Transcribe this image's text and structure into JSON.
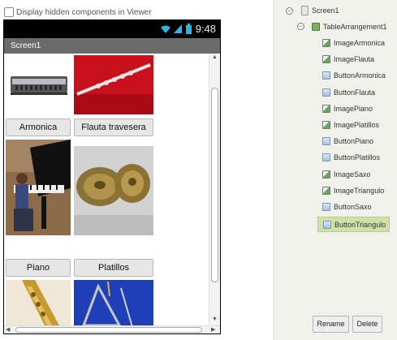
{
  "viewer": {
    "hidden_components_label": "Display hidden components in Viewer",
    "status_time": "9:48",
    "screen_title": "Screen1"
  },
  "grid": {
    "buttons": [
      "Armonica",
      "Flauta travesera",
      "Piano",
      "Platillos"
    ]
  },
  "components": {
    "root": "Screen1",
    "arrangement": "TableArrangement1",
    "children": [
      {
        "name": "ImageArmonica",
        "kind": "image"
      },
      {
        "name": "ImageFlauta",
        "kind": "image"
      },
      {
        "name": "ButtonArmonica",
        "kind": "button"
      },
      {
        "name": "ButtonFlauta",
        "kind": "button"
      },
      {
        "name": "ImagePiano",
        "kind": "image"
      },
      {
        "name": "ImagePlatillos",
        "kind": "image"
      },
      {
        "name": "ButtonPiano",
        "kind": "button"
      },
      {
        "name": "ButtonPlatillos",
        "kind": "button"
      },
      {
        "name": "ImageSaxo",
        "kind": "image"
      },
      {
        "name": "ImageTriangulo",
        "kind": "image"
      },
      {
        "name": "ButtonSaxo",
        "kind": "button"
      },
      {
        "name": "ButtonTriangulo",
        "kind": "button"
      }
    ],
    "selected": "ButtonTriangulo"
  },
  "actions": {
    "rename": "Rename",
    "delete": "Delete"
  }
}
